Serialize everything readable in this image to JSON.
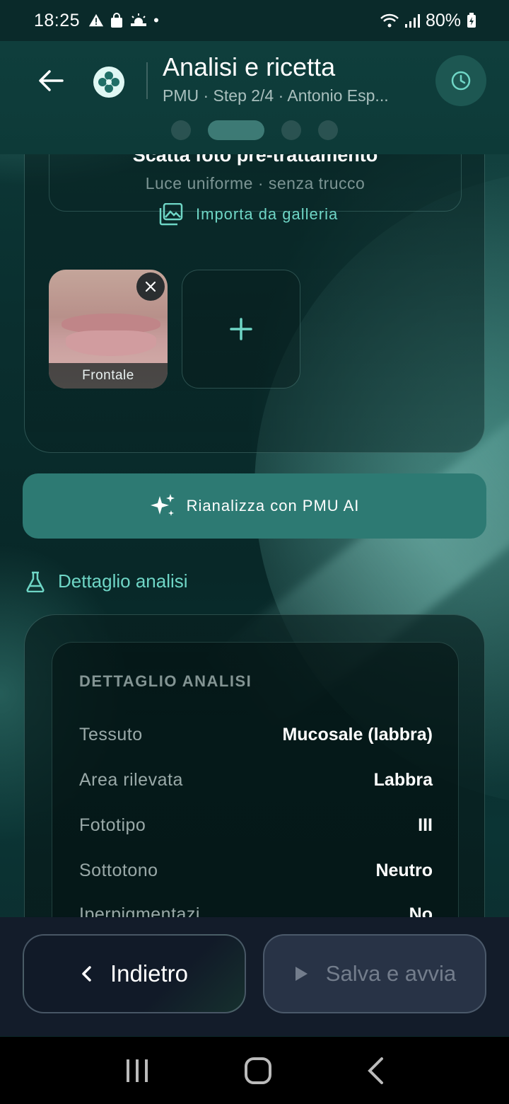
{
  "status": {
    "time": "18:25",
    "battery": "80%"
  },
  "header": {
    "title": "Analisi e ricetta",
    "subtitle": "PMU · Step 2/4 · Antonio Esp...",
    "steps_total": 4,
    "current_step": 2
  },
  "capture": {
    "title": "Scatta foto pre-trattamento",
    "hint": "Luce uniforme · senza trucco",
    "import_label": "Importa da galleria"
  },
  "photos": [
    {
      "label": "Frontale"
    }
  ],
  "reanalyze_label": "Rianalizza con PMU AI",
  "analysis": {
    "section_title": "Dettaglio analisi",
    "card_heading": "DETTAGLIO ANALISI",
    "rows": [
      {
        "key": "Tessuto",
        "value": "Mucosale (labbra)"
      },
      {
        "key": "Area rilevata",
        "value": "Labbra"
      },
      {
        "key": "Fototipo",
        "value": "III"
      },
      {
        "key": "Sottotono",
        "value": "Neutro"
      },
      {
        "key": "Iperpigmentazi",
        "value": "No"
      }
    ]
  },
  "footer": {
    "back_label": "Indietro",
    "save_label": "Salva e avvia"
  },
  "colors": {
    "accent": "#6fd6c6",
    "primary_button": "#2d7a73",
    "background": "#0a2f2f",
    "bottom_bar": "#131c2a"
  }
}
